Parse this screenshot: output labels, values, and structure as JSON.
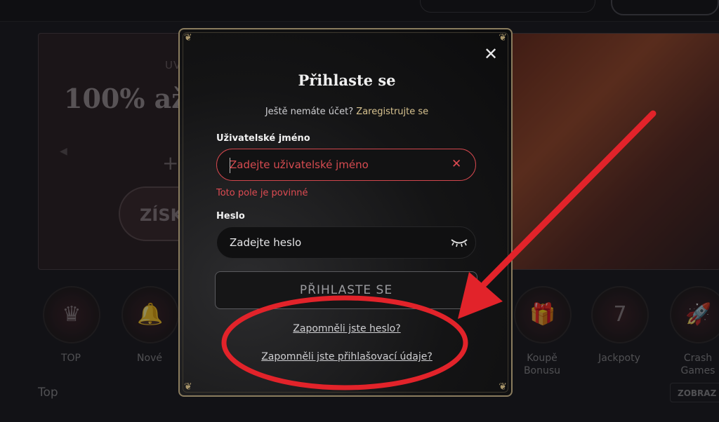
{
  "colors": {
    "accent_gold": "#d7c28f",
    "error_red": "#de4b52",
    "annotation_red": "#e2232a",
    "modal_border": "#8a7c5e"
  },
  "background": {
    "promo_kicker": "UV",
    "promo_title": "100% až",
    "promo_cta": "ZÍSK",
    "categories": [
      {
        "label": "TOP",
        "icon": "crown-icon"
      },
      {
        "label": "Nové",
        "icon": "bell-icon"
      },
      {
        "label": "Koupě Bonusu",
        "icon": "gift-icon"
      },
      {
        "label": "Jackpoty",
        "icon": "seven-icon"
      },
      {
        "label": "Crash Games",
        "icon": "rocket-icon"
      }
    ],
    "section_title": "Top",
    "section_button": "ZOBRAZ"
  },
  "modal": {
    "close_icon": "close-icon",
    "title": "Přihlaste se",
    "register_question": "Ještě nemáte účet?",
    "register_link": "Zaregistrujte se",
    "username": {
      "label": "Uživatelské jméno",
      "placeholder": "Zadejte uživatelské jméno",
      "value": "",
      "error": "Toto pole je povinné",
      "clear_icon": "clear-x-icon"
    },
    "password": {
      "label": "Heslo",
      "placeholder": "Zadejte heslo",
      "value": "",
      "toggle_icon": "eye-closed-icon"
    },
    "submit_label": "PŘIHLASTE SE",
    "forgot_password": "Zapomněli jste heslo?",
    "forgot_credentials": "Zapomněli jste přihlašovací údaje?"
  }
}
